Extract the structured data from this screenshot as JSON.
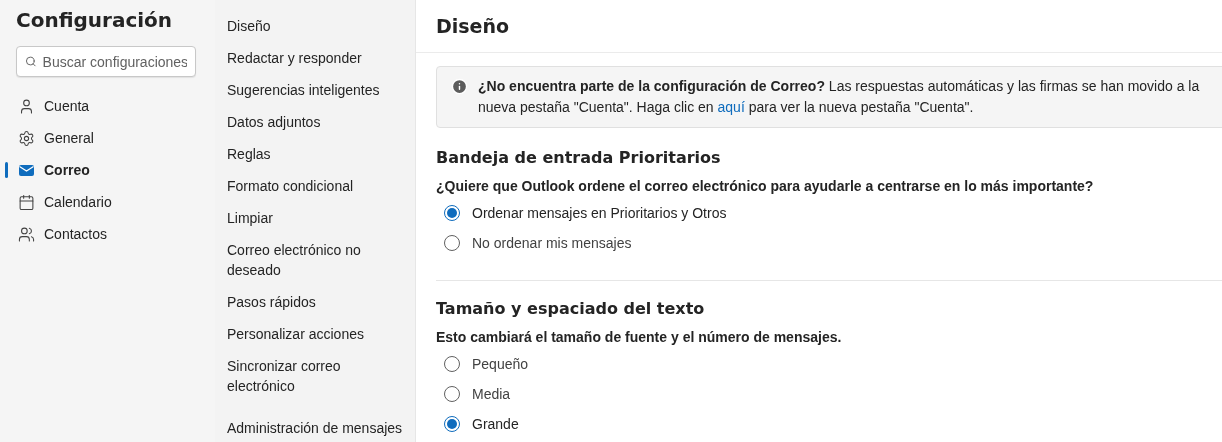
{
  "sidebar": {
    "title": "Configuración",
    "search": {
      "placeholder": "Buscar configuraciones"
    },
    "items": [
      {
        "label": "Cuenta",
        "selected": false
      },
      {
        "label": "General",
        "selected": false
      },
      {
        "label": "Correo",
        "selected": true
      },
      {
        "label": "Calendario",
        "selected": false
      },
      {
        "label": "Contactos",
        "selected": false
      }
    ]
  },
  "subnav": {
    "groups": [
      [
        "Diseño",
        "Redactar y responder",
        "Sugerencias inteligentes",
        "Datos adjuntos",
        "Reglas",
        "Formato condicional",
        "Limpiar",
        "Correo electrónico no deseado",
        "Pasos rápidos",
        "Personalizar acciones",
        "Sincronizar correo electrónico"
      ],
      [
        "Administración de mensajes"
      ]
    ]
  },
  "content": {
    "title": "Diseño",
    "notice": {
      "text_before": "**¿No encuentra parte de la configuración de Correo?** Las respuestas automáticas y las firmas se han movido a la nueva pestaña \"Cuenta\". Haga clic en",
      "link": "aquí",
      "text_after": "para ver la nueva pestaña \"Cuenta\"."
    },
    "sections": [
      {
        "heading": "Bandeja de entrada Prioritarios",
        "question": "¿Quiere que Outlook ordene el correo electrónico para ayudarle a centrarse en lo más importante?",
        "options": [
          {
            "label": "Ordenar mensajes en Prioritarios y Otros",
            "selected": true
          },
          {
            "label": "No ordenar mis mensajes",
            "selected": false
          }
        ]
      },
      {
        "heading": "Tamaño y espaciado del texto",
        "question": "Esto cambiará el tamaño de fuente y el número de mensajes.",
        "options": [
          {
            "label": "Pequeño",
            "selected": false
          },
          {
            "label": "Media",
            "selected": false
          },
          {
            "label": "Grande",
            "selected": true
          }
        ]
      }
    ]
  }
}
